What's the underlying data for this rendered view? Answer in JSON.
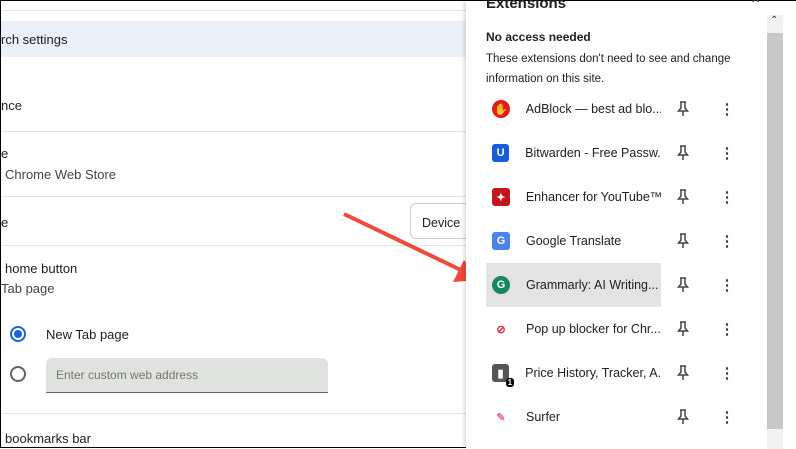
{
  "settings": {
    "search_settings": "rch settings",
    "appearance_frag": "nce",
    "theme_frag": "e",
    "theme_sub": "Chrome Web Store",
    "mode_frag": "e",
    "mode_button": "Device",
    "home_button": "home button",
    "home_sub": "Tab page",
    "radio_newtab": "New Tab page",
    "custom_placeholder": "Enter custom web address",
    "bookmarks": "bookmarks bar"
  },
  "panel": {
    "title": "Extensions",
    "section_title": "No access needed",
    "section_desc": "These extensions don't need to see and change information on this site.",
    "extensions": [
      {
        "name": "AdBlock — best ad blo...",
        "icon": "adblock-hand-icon",
        "color": "#e31b1b"
      },
      {
        "name": "Bitwarden - Free Passw...",
        "icon": "bitwarden-shield-icon",
        "color": "#175ddc"
      },
      {
        "name": "Enhancer for YouTube™",
        "icon": "enhancer-wand-icon",
        "color": "#c4161c"
      },
      {
        "name": "Google Translate",
        "icon": "google-translate-icon",
        "color": "#4a84e8"
      },
      {
        "name": "Grammarly: AI Writing...",
        "icon": "grammarly-icon",
        "color": "#15865e"
      },
      {
        "name": "Pop up blocker for Chr...",
        "icon": "popup-blocker-icon",
        "color": "#e0233a"
      },
      {
        "name": "Price History, Tracker, A...",
        "icon": "price-history-icon",
        "color": "#555555",
        "badge": "1"
      },
      {
        "name": "Surfer",
        "icon": "surfer-icon",
        "color": "#f06c8a"
      }
    ]
  },
  "colors": {
    "arrow": "#f04a3a",
    "accent": "#1a63d8",
    "search_band": "#ecf0f8"
  }
}
